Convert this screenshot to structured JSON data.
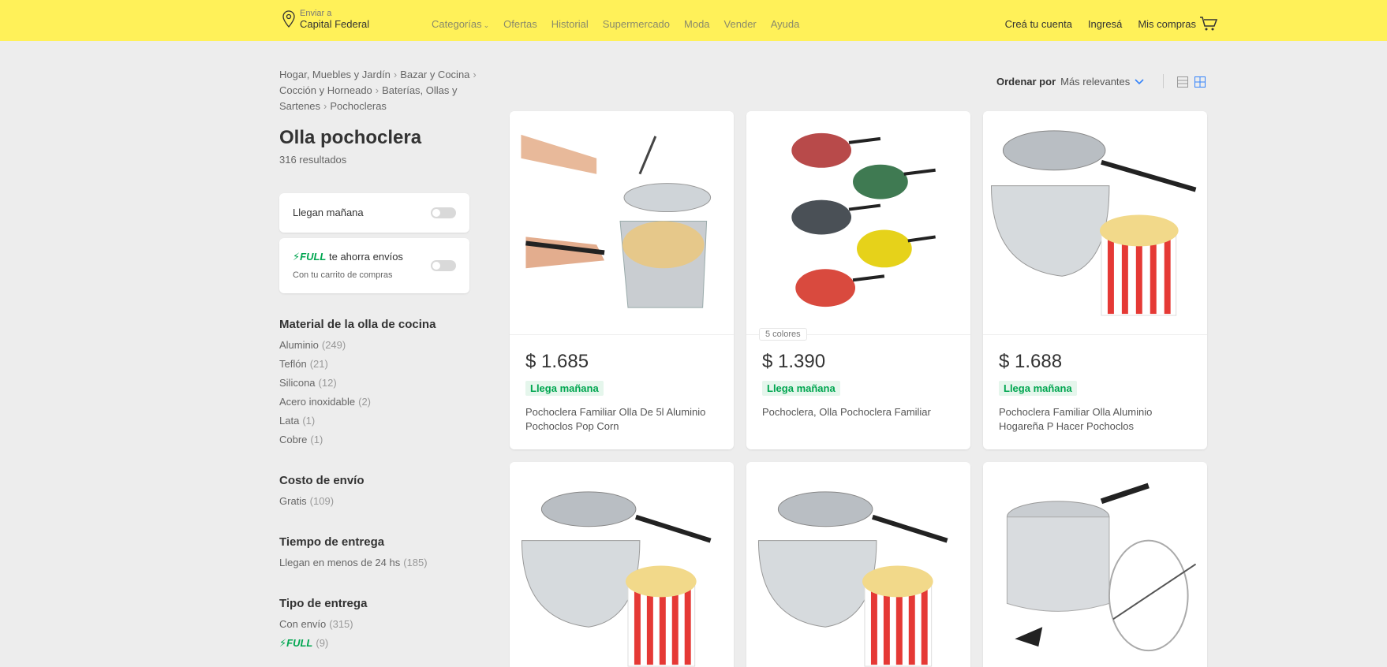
{
  "header": {
    "location_small": "Enviar a",
    "location_big": "Capital Federal",
    "nav": [
      "Categorías",
      "Ofertas",
      "Historial",
      "Supermercado",
      "Moda",
      "Vender",
      "Ayuda"
    ],
    "account": [
      "Creá tu cuenta",
      "Ingresá",
      "Mis compras"
    ],
    "cart_icon": "cart-icon"
  },
  "breadcrumb": [
    "Hogar, Muebles y Jardín",
    "Bazar y Cocina",
    "Cocción y Horneado",
    "Baterías, Ollas y Sartenes",
    "Pochocleras"
  ],
  "search": {
    "title": "Olla pochoclera",
    "results": "316 resultados"
  },
  "quick_filters": {
    "tomorrow": "Llegan mañana",
    "full_brand": "FULL",
    "full_text": "te ahorra envíos",
    "full_sub": "Con tu carrito de compras"
  },
  "filters": [
    {
      "title": "Material de la olla de cocina",
      "items": [
        {
          "label": "Aluminio",
          "count": "(249)"
        },
        {
          "label": "Teflón",
          "count": "(21)"
        },
        {
          "label": "Silicona",
          "count": "(12)"
        },
        {
          "label": "Acero inoxidable",
          "count": "(2)"
        },
        {
          "label": "Lata",
          "count": "(1)"
        },
        {
          "label": "Cobre",
          "count": "(1)"
        }
      ]
    },
    {
      "title": "Costo de envío",
      "items": [
        {
          "label": "Gratis",
          "count": "(109)"
        }
      ]
    },
    {
      "title": "Tiempo de entrega",
      "items": [
        {
          "label": "Llegan en menos de 24 hs",
          "count": "(185)"
        }
      ]
    },
    {
      "title": "Tipo de entrega",
      "items": [
        {
          "label": "Con envío",
          "count": "(315)"
        },
        {
          "label": "FULL",
          "count": "(9)"
        }
      ]
    }
  ],
  "sort": {
    "label": "Ordenar por",
    "value": "Más relevantes"
  },
  "products": [
    {
      "price": "$ 1.685",
      "badge": "Llega mañana",
      "title": "Pochoclera Familiar Olla De 5l Aluminio Pochoclos Pop Corn"
    },
    {
      "price": "$ 1.390",
      "badge": "Llega mañana",
      "title": "Pochoclera, Olla Pochoclera Familiar",
      "colors": "5 colores"
    },
    {
      "price": "$ 1.688",
      "badge": "Llega mañana",
      "title": "Pochoclera Familiar Olla Aluminio Hogareña P Hacer Pochoclos"
    },
    {},
    {},
    {}
  ],
  "colors": {
    "header": "#fff159",
    "accent": "#3483fa",
    "green": "#00a650"
  }
}
